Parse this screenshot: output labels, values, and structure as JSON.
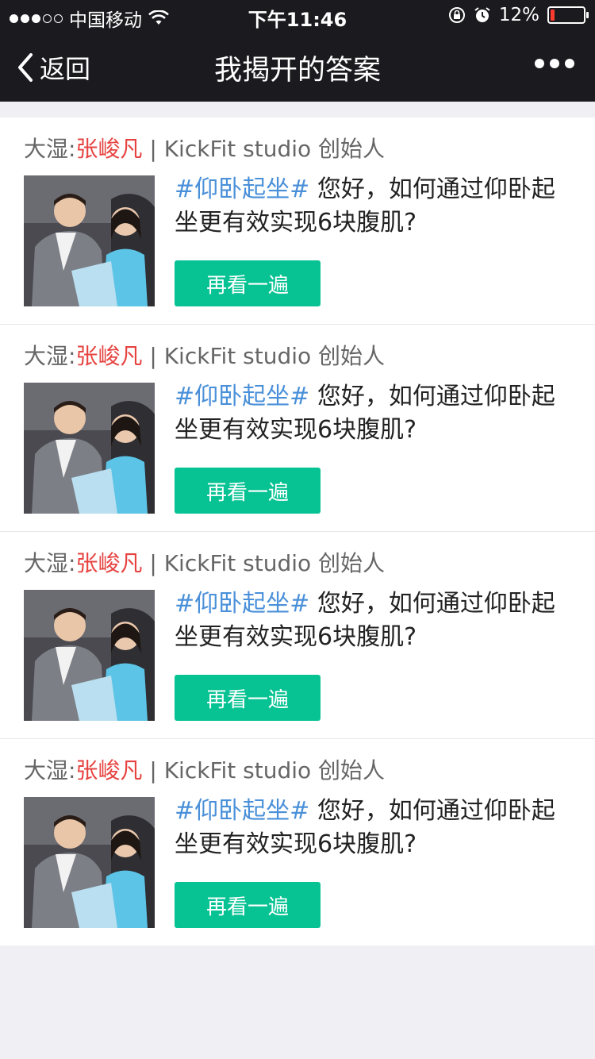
{
  "status_bar": {
    "carrier": "中国移动",
    "time": "下午11:46",
    "battery": "12%",
    "battery_level": 0.12,
    "signal_bars": 3
  },
  "nav": {
    "back_label": "返回",
    "title": "我揭开的答案"
  },
  "items": [
    {
      "prefix": "大湿:",
      "name": "张峻凡",
      "suffix": " | KickFit studio 创始人",
      "tag": "#仰卧起坐#",
      "question": " 您好，如何通过仰卧起坐更有效实现6块腹肌?",
      "button": "再看一遍"
    },
    {
      "prefix": "大湿:",
      "name": "张峻凡",
      "suffix": " | KickFit studio 创始人",
      "tag": "#仰卧起坐#",
      "question": " 您好，如何通过仰卧起坐更有效实现6块腹肌?",
      "button": "再看一遍"
    },
    {
      "prefix": "大湿:",
      "name": "张峻凡",
      "suffix": " | KickFit studio 创始人",
      "tag": "#仰卧起坐#",
      "question": " 您好，如何通过仰卧起坐更有效实现6块腹肌?",
      "button": "再看一遍"
    },
    {
      "prefix": "大湿:",
      "name": "张峻凡",
      "suffix": " | KickFit studio 创始人",
      "tag": "#仰卧起坐#",
      "question": " 您好，如何通过仰卧起坐更有效实现6块腹肌?",
      "button": "再看一遍"
    }
  ],
  "colors": {
    "bar_bg": "#1b1a1f",
    "accent_green": "#07c393",
    "name_red": "#e64340",
    "tag_blue": "#4a90d9"
  }
}
